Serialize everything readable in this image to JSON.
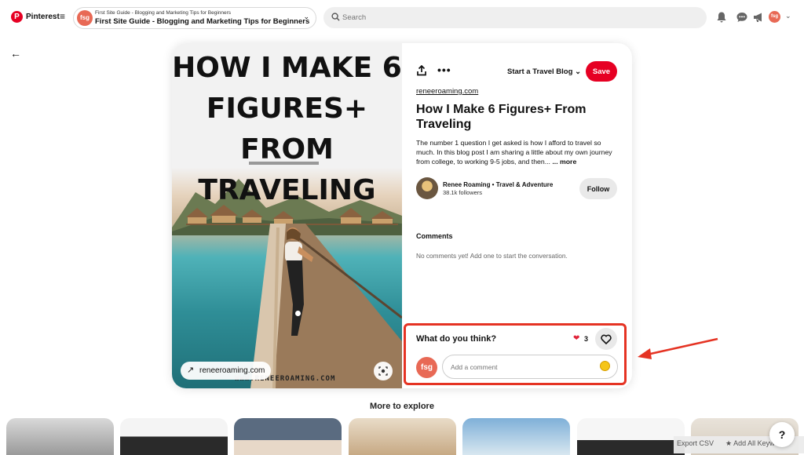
{
  "topbar": {
    "brand": "Pinterest",
    "board_small": "First Site Guide - Blogging and Marketing Tips for Beginners",
    "board_big": "First Site Guide - Blogging and Marketing Tips for Beginners",
    "avatar_text": "fsg",
    "search_placeholder": "Search"
  },
  "pin": {
    "image_title": "HOW I MAKE 6 FIGURES+ FROM TRAVELING",
    "image_url_footer": "WWW.RENEEROAMING.COM",
    "link_label": "reneeroaming.com",
    "board_select": "Start a Travel Blog",
    "save_label": "Save",
    "domain": "reneeroaming.com",
    "title": "How I Make 6 Figures+ From Traveling",
    "description": "The number 1 question I get asked is how I afford to travel so much. In this blog post I am sharing a little about my own journey from college, to working 9-5 jobs, and then... ",
    "more_label": "... more",
    "creator_name": "Renee Roaming • Travel & Adventure",
    "creator_followers": "38.1k followers",
    "follow_label": "Follow",
    "comments_label": "Comments",
    "no_comments": "No comments yet! Add one to start the conversation.",
    "what_do_you_think": "What do you think?",
    "reaction_count": "3",
    "comment_placeholder": "Add a comment",
    "my_avatar_text": "fsg"
  },
  "footer": {
    "more_to_explore": "More to explore",
    "export_csv": "Export CSV",
    "add_all_keywords": "★ Add All Keywords",
    "help": "?"
  },
  "colors": {
    "brand_red": "#e60023",
    "highlight_red": "#e53323",
    "fsg_avatar": "#e86955"
  }
}
